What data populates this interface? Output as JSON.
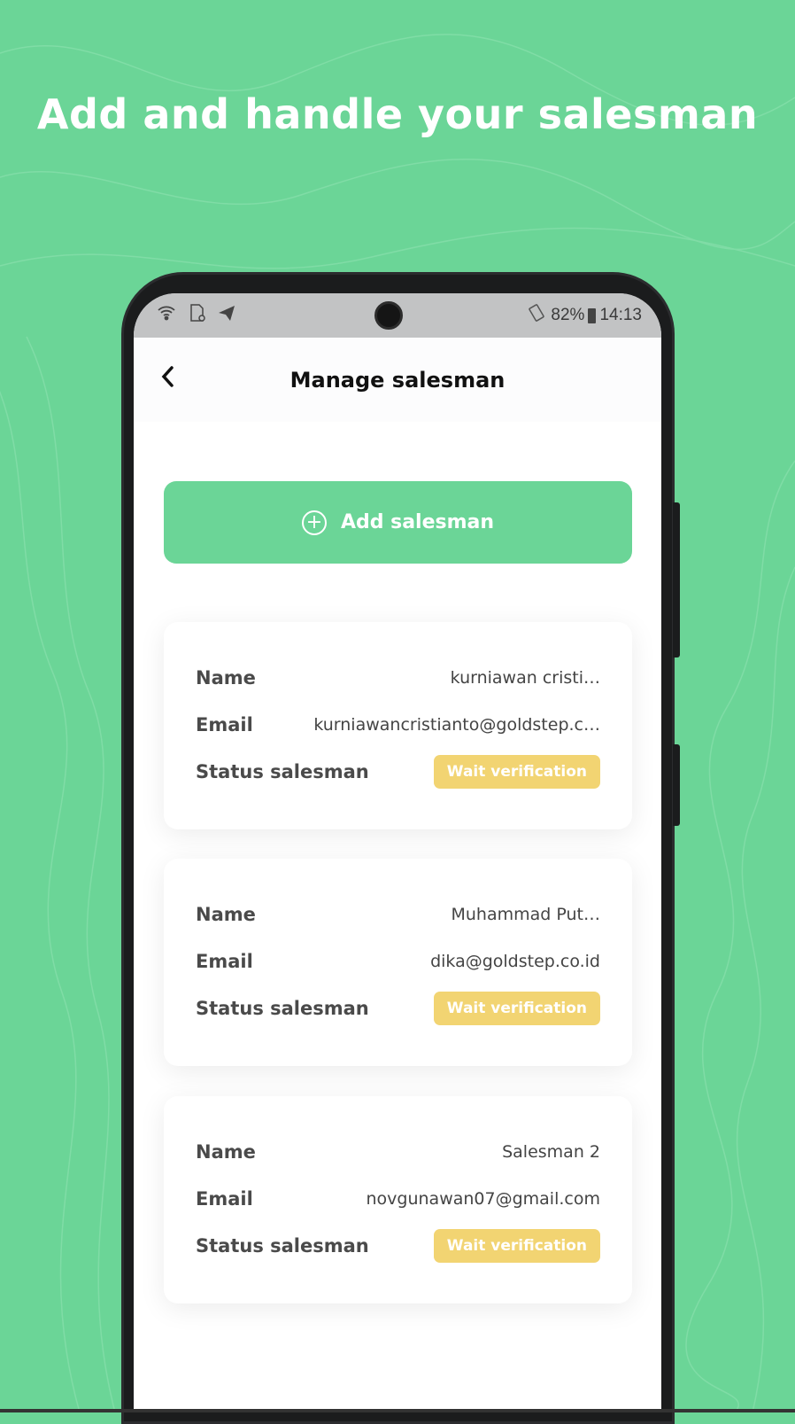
{
  "headline": "Add and handle your salesman",
  "status_bar": {
    "battery": "82%",
    "time": "14:13"
  },
  "header": {
    "title": "Manage salesman"
  },
  "add_button": {
    "label": "Add salesman"
  },
  "labels": {
    "name": "Name",
    "email": "Email",
    "status": "Status salesman"
  },
  "salesmen": [
    {
      "name": "kurniawan cristi…",
      "email": "kurniawancristianto@goldstep.c…",
      "status": "Wait verification"
    },
    {
      "name": "Muhammad Put…",
      "email": "dika@goldstep.co.id",
      "status": "Wait verification"
    },
    {
      "name": "Salesman 2",
      "email": "novgunawan07@gmail.com",
      "status": "Wait verification"
    }
  ],
  "colors": {
    "accent": "#6bd597",
    "badge": "#f2d472"
  }
}
